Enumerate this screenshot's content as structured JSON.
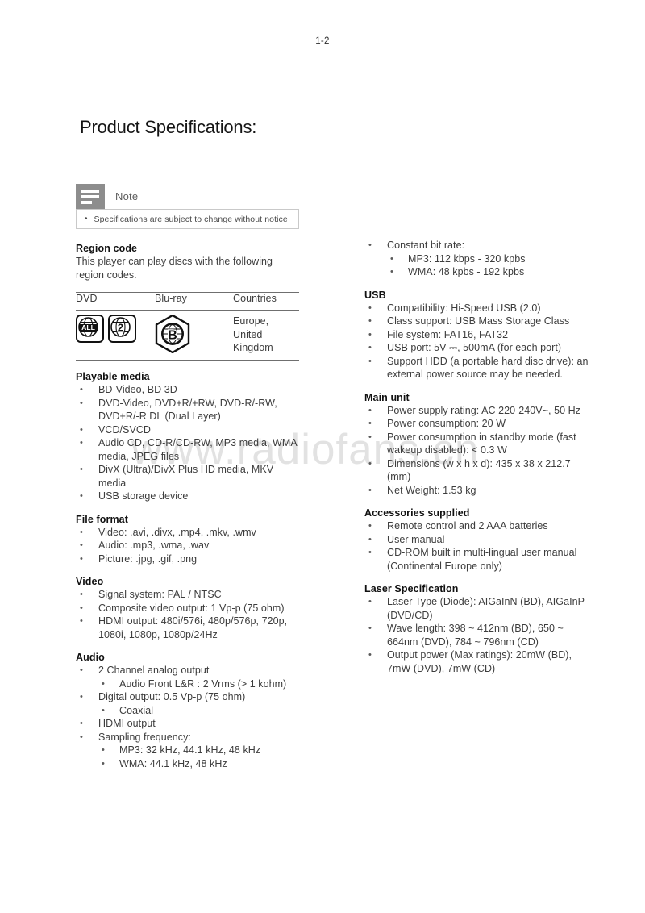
{
  "page": {
    "number": "1-2",
    "title": "Product Specifications:",
    "watermark": "www.radiofans.cn"
  },
  "note": {
    "icon": "note-icon",
    "label": "Note",
    "items": [
      "Specifications are subject to change without notice"
    ]
  },
  "left_column": {
    "region_code": {
      "heading": "Region code",
      "paragraph": "This player can play discs with the following region codes.",
      "table": {
        "headers": [
          "DVD",
          "Blu-ray",
          "Countries"
        ],
        "row": {
          "dvd_icons": [
            "ALL",
            "2"
          ],
          "bluray_icon": "B",
          "countries": "Europe, United Kingdom"
        }
      }
    },
    "playable_media": {
      "heading": "Playable media",
      "items": [
        "BD-Video, BD 3D",
        "DVD-Video, DVD+R/+RW, DVD-R/-RW, DVD+R/-R DL (Dual Layer)",
        "VCD/SVCD",
        "Audio CD, CD-R/CD-RW, MP3 media, WMA media, JPEG files",
        "DivX (Ultra)/DivX Plus HD media, MKV media",
        "USB storage device"
      ]
    },
    "file_format": {
      "heading": "File format",
      "items": [
        "Video: .avi, .divx, .mp4, .mkv, .wmv",
        "Audio: .mp3, .wma, .wav",
        "Picture: .jpg, .gif, .png"
      ]
    },
    "video": {
      "heading": "Video",
      "items": [
        "Signal system: PAL / NTSC",
        "Composite video output: 1 Vp-p (75 ohm)",
        "HDMI output: 480i/576i, 480p/576p, 720p, 1080i, 1080p, 1080p/24Hz"
      ]
    },
    "audio": {
      "heading": "Audio",
      "items": [
        {
          "text": "2 Channel analog output",
          "sub": [
            "Audio Front L&R : 2 Vrms (> 1 kohm)"
          ]
        },
        {
          "text": "Digital output: 0.5 Vp-p (75 ohm)",
          "sub": [
            "Coaxial"
          ]
        },
        {
          "text": "HDMI output",
          "sub": []
        },
        {
          "text": "Sampling frequency:",
          "sub": [
            "MP3: 32 kHz, 44.1 kHz, 48 kHz",
            "WMA: 44.1 kHz, 48 kHz"
          ]
        }
      ]
    }
  },
  "right_column": {
    "bit_rate": {
      "items": [
        {
          "text": "Constant bit rate:",
          "sub": [
            "MP3: 112 kbps - 320 kpbs",
            "WMA: 48 kpbs - 192 kpbs"
          ]
        }
      ]
    },
    "usb": {
      "heading": "USB",
      "items": [
        "Compatibility: Hi-Speed USB (2.0)",
        "Class support: USB Mass Storage Class",
        "File system: FAT16, FAT32",
        "USB port: 5V ⎓, 500mA (for each port)",
        "Support HDD (a portable hard disc drive): an external power source may be needed."
      ]
    },
    "main_unit": {
      "heading": "Main unit",
      "items": [
        "Power supply rating: AC 220-240V~, 50 Hz",
        "Power consumption: 20 W",
        "Power consumption in standby mode (fast wakeup disabled): < 0.3 W",
        "Dimensions (w x h x d): 435 x 38 x 212.7 (mm)",
        "Net Weight: 1.53 kg"
      ]
    },
    "accessories": {
      "heading": "Accessories supplied",
      "items": [
        "Remote control and 2 AAA batteries",
        "User manual",
        "CD-ROM built in multi-lingual user manual (Continental Europe only)"
      ]
    },
    "laser": {
      "heading": "Laser Specification",
      "items": [
        "Laser Type (Diode): AIGaInN (BD), AIGaInP (DVD/CD)",
        "Wave length: 398 ~ 412nm (BD), 650 ~ 664nm (DVD), 784 ~ 796nm (CD)",
        "Output power (Max ratings): 20mW (BD), 7mW (DVD), 7mW (CD)"
      ]
    }
  },
  "symbols": {
    "bullet": "•"
  }
}
